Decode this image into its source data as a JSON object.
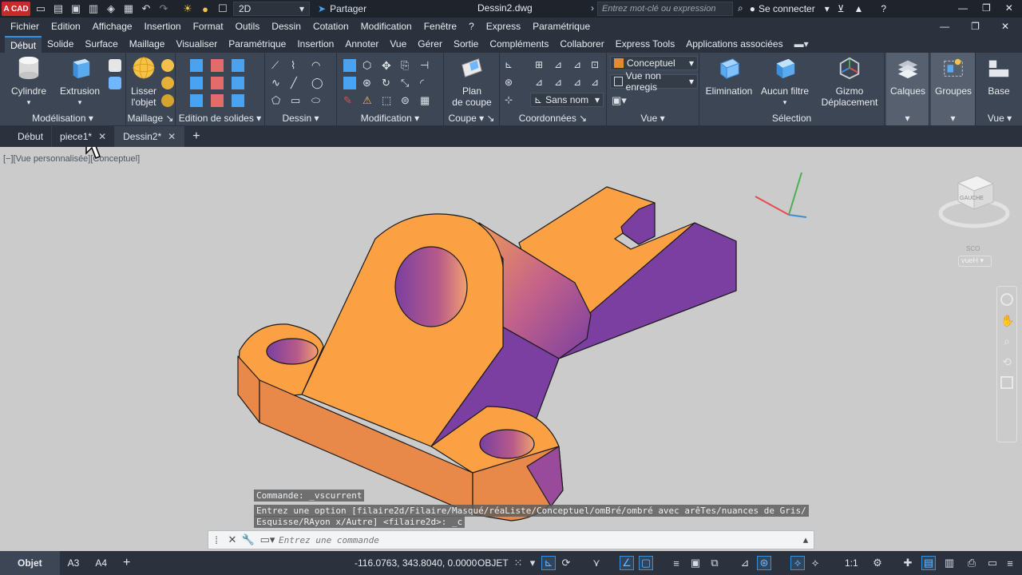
{
  "app": {
    "logo_text": "A CAD",
    "workspace": "2D",
    "share_label": "Partager",
    "document_title": "Dessin2.dwg",
    "search_placeholder": "Entrez mot-clé ou expression",
    "signin_label": "Se connecter"
  },
  "menu": [
    "Fichier",
    "Edition",
    "Affichage",
    "Insertion",
    "Format",
    "Outils",
    "Dessin",
    "Cotation",
    "Modification",
    "Fenêtre",
    "?",
    "Express",
    "Paramétrique"
  ],
  "ribbon_tabs": [
    "Début",
    "Solide",
    "Surface",
    "Maillage",
    "Visualiser",
    "Paramétrique",
    "Insertion",
    "Annoter",
    "Vue",
    "Gérer",
    "Sortie",
    "Compléments",
    "Collaborer",
    "Express Tools",
    "Applications associées"
  ],
  "ribbon": {
    "panels": {
      "modelisation": "Modélisation",
      "maillage": "Maillage",
      "edition_solides": "Edition de solides",
      "dessin": "Dessin",
      "modification": "Modification",
      "coupe": "Coupe",
      "coordonnees": "Coordonnées",
      "vue": "Vue",
      "selection": "Sélection",
      "vue2": "Vue"
    },
    "buttons": {
      "cylindre": "Cylindre",
      "extrusion": "Extrusion",
      "lisser_1": "Lisser",
      "lisser_2": "l'objet",
      "plan_1": "Plan",
      "plan_2": "de coupe",
      "elimination": "Elimination",
      "aucun_filtre": "Aucun filtre",
      "gizmo_1": "Gizmo",
      "gizmo_2": "Déplacement",
      "calques": "Calques",
      "groupes": "Groupes",
      "base": "Base"
    },
    "visual_style": "Conceptuel",
    "named_view": "Vue non enregis",
    "ucs_name": "Sans nom"
  },
  "doc_tabs": [
    {
      "label": "Début"
    },
    {
      "label": "piece1*"
    },
    {
      "label": "Dessin2*"
    }
  ],
  "viewport": {
    "label": "[−][Vue personnalisée][Conceptuel]",
    "viewcube_label": "GAUCHE",
    "viewcube_compass": "SCO",
    "viewcube_ucs": "vueH"
  },
  "command": {
    "history_1": "Commande: _vscurrent",
    "history_2": "Entrez une option [filaire2d/Filaire/Masqué/réaListe/Conceptuel/omBré/ombré avec arêTes/nuances de Gris/",
    "history_3": "Esquisse/RAyon x/Autre] <filaire2d>: _c",
    "placeholder": "Entrez une commande"
  },
  "status": {
    "layouts": [
      "Objet",
      "A3",
      "A4"
    ],
    "coordinates": "-116.0763, 343.8040, 0.0000",
    "mode": "OBJET",
    "scale": "1:1"
  },
  "colors": {
    "accent": "#3a8fdb",
    "solid_top": "#fca044",
    "solid_side": "#e8894a",
    "solid_shadow": "#7a3fa0"
  }
}
